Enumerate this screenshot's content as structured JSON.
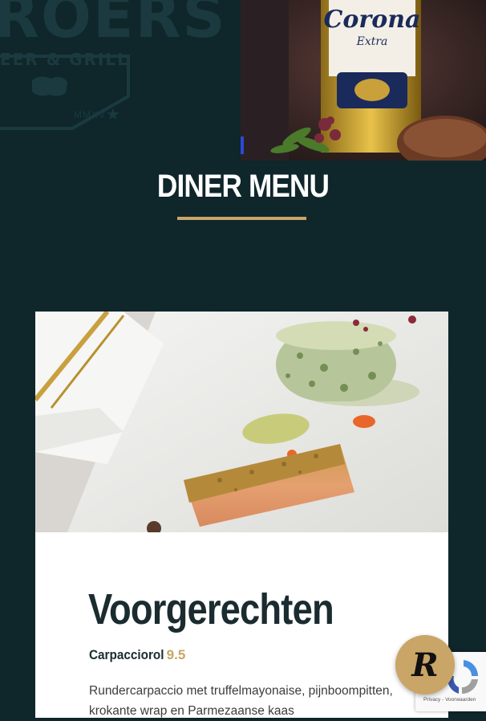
{
  "logo": {
    "word": "ROERS",
    "subtitle": "EER & GRILL",
    "year": "MMXV"
  },
  "hero_photo": {
    "brand_text": "Corona",
    "brand_sub": "Extra"
  },
  "section": {
    "title": "DINER MENU"
  },
  "card": {
    "course_title": "Voorgerechten",
    "dishes": [
      {
        "name": "Carpacciorol",
        "price": "9.5",
        "description": "Rundercarpaccio met truffelmayonaise, pijnboompitten, krokante wrap en Parmezaanse kaas"
      }
    ]
  },
  "recaptcha": {
    "text": "Privacy - Voorwaarden"
  },
  "badge": {
    "letter": "R"
  },
  "colors": {
    "background": "#0f262b",
    "accent": "#c9a567",
    "card": "#ffffff"
  }
}
